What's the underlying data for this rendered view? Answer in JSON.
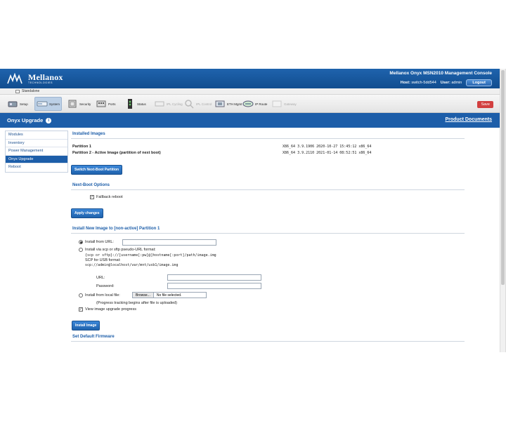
{
  "header": {
    "brand": "Mellanox",
    "brand_tag": "TECHNOLOGIES",
    "console_title": "Mellanox Onyx MSN2010 Management Console",
    "host_label": "Host:",
    "host_value": "switch-5dd544",
    "user_label": "User:",
    "user_value": "admin",
    "logout": "Logout",
    "mode": "Standalone"
  },
  "toolbar": {
    "items": [
      {
        "label": "Setup",
        "icon": "setup-icon"
      },
      {
        "label": "System",
        "icon": "system-icon",
        "active": true
      },
      {
        "label": "Security",
        "icon": "security-icon"
      },
      {
        "label": "Ports",
        "icon": "ports-icon"
      },
      {
        "label": "Status",
        "icon": "status-icon"
      },
      {
        "label": "IPL Cycling",
        "icon": "ipl-icon",
        "disabled": true
      },
      {
        "label": "IPL Control",
        "icon": "ipl-control-icon",
        "disabled": true
      },
      {
        "label": "ETH Mgmt",
        "icon": "eth-mgmt-icon"
      },
      {
        "label": "IP Route",
        "icon": "ip-route-icon"
      },
      {
        "label": "Gateway",
        "icon": "gateway-icon",
        "disabled": true
      }
    ],
    "save": "Save"
  },
  "page": {
    "title": "Onyx Upgrade",
    "product_docs": "Product Documents"
  },
  "sidebar": {
    "items": [
      {
        "label": "Modules"
      },
      {
        "label": "Inventory"
      },
      {
        "label": "Power Management"
      },
      {
        "label": "Onyx Upgrade",
        "active": true
      },
      {
        "label": "Reboot"
      }
    ]
  },
  "installed": {
    "title": "Installed Images",
    "rows": [
      {
        "name": "Partition 1",
        "version": "X86_64 3.9.1906 2020-10-27 15:45:12 x86_64"
      },
      {
        "name": "Partition 2 - Active Image (partition of next boot)",
        "version": "X86_64 3.9.2110 2021-01-14 08:52:51 x86_64"
      }
    ],
    "switch_button": "Switch Next-Boot Partition"
  },
  "next_boot": {
    "title": "Next-Boot Options",
    "fallback_label": "Fallback reboot",
    "fallback_checked": true,
    "apply_button": "Apply changes"
  },
  "install_new": {
    "title": "Install New Image to [non-active] Partition 1",
    "url_label": "Install from URL:",
    "url_value": "",
    "scp_label": "Install via scp or sftp pseudo-URL format:",
    "scp_format": "{scp or sftp}://[username[:pw]@]hostname[:port]/path/image.img",
    "usb_label": "SCP for USB format:",
    "usb_format": "scp://admin@localhost/var/mnt/usb1/image.img",
    "scp_url_label": "URL:",
    "scp_password_label": "Password:",
    "local_label": "Install from local file:",
    "browse": "Browse...",
    "no_file": "No file selected.",
    "progress_note": "(Progress tracking begins after file is uploaded)",
    "view_progress_label": "View image upgrade progress",
    "view_progress_checked": true,
    "install_button": "Install Image"
  },
  "default_fw": {
    "title": "Set Default Firmware"
  }
}
